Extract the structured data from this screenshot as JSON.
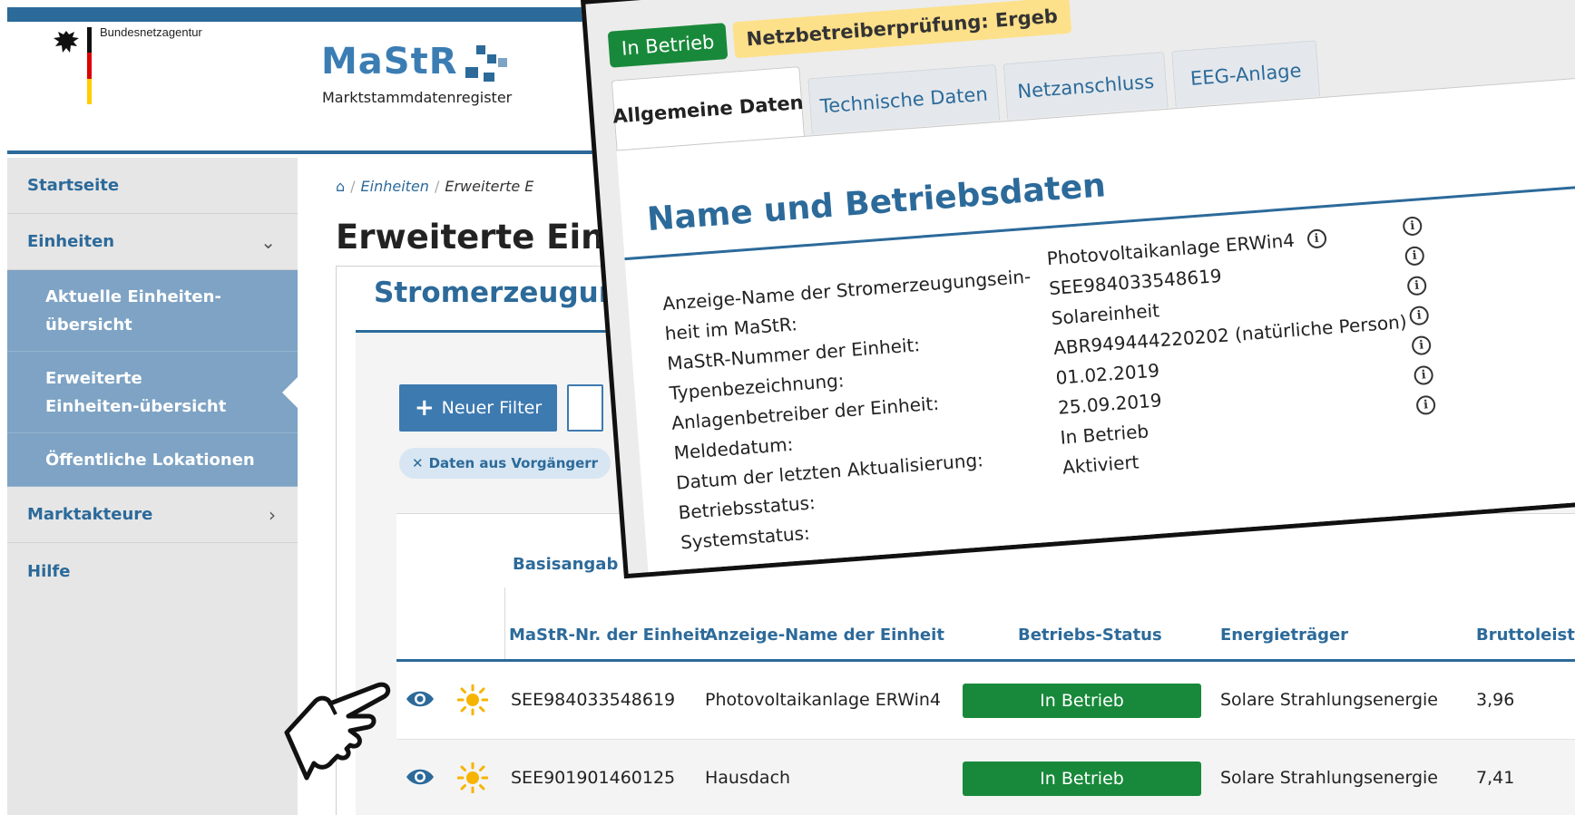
{
  "header": {
    "agency": "Bundesnetzagentur",
    "logo_text": "MaStR",
    "logo_subtitle": "Marktstammdatenregister"
  },
  "sidebar": {
    "items": [
      {
        "label": "Startseite"
      },
      {
        "label": "Einheiten"
      },
      {
        "label": "Aktuelle Einheiten-übersicht"
      },
      {
        "label": "Erweiterte Einheiten-übersicht"
      },
      {
        "label": "Öffentliche Lokationen"
      },
      {
        "label": "Marktakteure"
      },
      {
        "label": "Hilfe"
      }
    ]
  },
  "breadcrumb": {
    "items": [
      "Einheiten",
      "Erweiterte E"
    ]
  },
  "page": {
    "title": "Erweiterte Einh",
    "section_heading": "Stromerzeugun"
  },
  "toolbar": {
    "new_filter_label": "Neuer Filter",
    "chip_label": "Daten aus Vorgängerr"
  },
  "table": {
    "group_header": "Basisangab",
    "columns": [
      "MaStR-Nr. der Einheit",
      "Anzeige-Name der Einheit",
      "Betriebs-Status",
      "Energieträger",
      "Bruttoleist"
    ],
    "rows": [
      {
        "nr": "SEE984033548619",
        "name": "Photovoltaikanlage ERWin4",
        "status": "In Betrieb",
        "energy": "Solare Strahlungsenergie",
        "power": "3,96"
      },
      {
        "nr": "SEE901901460125",
        "name": "Hausdach",
        "status": "In Betrieb",
        "energy": "Solare Strahlungsenergie",
        "power": "7,41"
      }
    ]
  },
  "detail": {
    "status_badge": "In Betrieb",
    "review_badge": "Netzbetreiberprüfung: Ergeb",
    "tabs": [
      "Allgemeine Daten",
      "Technische Daten",
      "Netzanschluss",
      "EEG-Anlage"
    ],
    "title": "Name und Betriebsdaten",
    "labels": [
      "Anzeige-Name der Stromerzeugungsein-",
      "heit im MaStR:",
      "MaStR-Nummer der Einheit:",
      "Typenbezeichnung:",
      "Anlagenbetreiber der Einheit:",
      "Meldedatum:",
      "Datum der letzten Aktualisierung:",
      "Betriebsstatus:",
      "Systemstatus:"
    ],
    "values": [
      "Photovoltaikanlage ERWin4",
      "SEE984033548619",
      "Solareinheit",
      "ABR949444220202 (natürliche Person)",
      "01.02.2019",
      "25.09.2019",
      "In Betrieb",
      "Aktiviert"
    ]
  },
  "colors": {
    "brand_blue": "#2c6a9a",
    "status_green": "#18893a",
    "warning_yellow": "#fde08a",
    "sidebar_active": "#7ea3c4"
  }
}
